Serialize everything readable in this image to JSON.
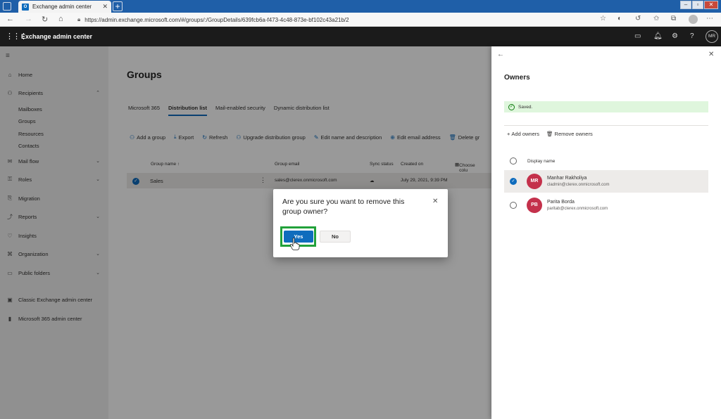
{
  "browser": {
    "tab_title": "Exchange admin center",
    "tab_logo": "O",
    "url": "https://admin.exchange.microsoft.com/#/groups/:/GroupDetails/639fcb6a-f473-4c48-873e-bf102c43a21b/2",
    "icons": [
      "back-icon",
      "forward-icon",
      "refresh-icon",
      "home-icon",
      "lock-icon",
      "favorite-icon",
      "extensions-icon",
      "collections-icon",
      "profile-icon",
      "more-icon"
    ]
  },
  "header": {
    "title": "Exchange admin center",
    "user_initials": "MR"
  },
  "sidebar": {
    "items": [
      {
        "label": "Home",
        "icon": "⌂"
      },
      {
        "label": "Recipients",
        "icon": "⚇",
        "chevron": "⌃"
      },
      {
        "label": "Mail flow",
        "icon": "✉",
        "chevron": "⌄"
      },
      {
        "label": "Roles",
        "icon": "⚿",
        "chevron": "⌄"
      },
      {
        "label": "Migration",
        "icon": "⎘"
      },
      {
        "label": "Reports",
        "icon": "⤴",
        "chevron": "⌄"
      },
      {
        "label": "Insights",
        "icon": "♡"
      },
      {
        "label": "Organization",
        "icon": "⌘",
        "chevron": "⌄"
      },
      {
        "label": "Public folders",
        "icon": "▭",
        "chevron": "⌄"
      },
      {
        "label": "Classic Exchange admin center",
        "icon": "▣"
      },
      {
        "label": "Microsoft 365 admin center",
        "icon": "▮"
      }
    ],
    "recipients_sub": [
      "Mailboxes",
      "Groups",
      "Resources",
      "Contacts"
    ]
  },
  "main": {
    "title": "Groups",
    "tabs": [
      "Microsoft 365",
      "Distribution list",
      "Mail-enabled security",
      "Dynamic distribution list"
    ],
    "toolbar": [
      {
        "label": "Add a group",
        "icon": "⚇"
      },
      {
        "label": "Export",
        "icon": "⤓"
      },
      {
        "label": "Refresh",
        "icon": "↻"
      },
      {
        "label": "Upgrade distribution group",
        "icon": "⚇"
      },
      {
        "label": "Edit name and description",
        "icon": "✎"
      },
      {
        "label": "Edit email address",
        "icon": "⊕"
      },
      {
        "label": "Delete gr",
        "icon": "🗑"
      }
    ],
    "columns": {
      "group_name": "Group name ↑",
      "group_email": "Group email",
      "sync_status": "Sync status",
      "created_on": "Created on",
      "choose_columns": "Choose colu"
    },
    "rows": [
      {
        "name": "Sales",
        "email": "sales@clerex.onmicrosoft.com",
        "sync": "☁",
        "created": "July 29, 2021, 9:39 PM"
      }
    ]
  },
  "panel": {
    "title": "Owners",
    "saved_text": "Saved.",
    "add_owners": "Add owners",
    "remove_owners": "Remove owners",
    "display_name_header": "Display name",
    "owners": [
      {
        "initials": "MR",
        "name": "Manhar Rakholiya",
        "email": "cladmin@clerex.onmicrosoft.com",
        "selected": true
      },
      {
        "initials": "PB",
        "name": "Parita Borda",
        "email": "paritab@clerex.onmicrosoft.com",
        "selected": false
      }
    ]
  },
  "dialog": {
    "message": "Are you sure you want to remove this group owner?",
    "yes_label": "Yes",
    "no_label": "No"
  },
  "colors": {
    "accent": "#0f6cbd",
    "highlight": "#22a13a",
    "avatar": "#c4314b",
    "saved_bg": "#dff6dd"
  }
}
